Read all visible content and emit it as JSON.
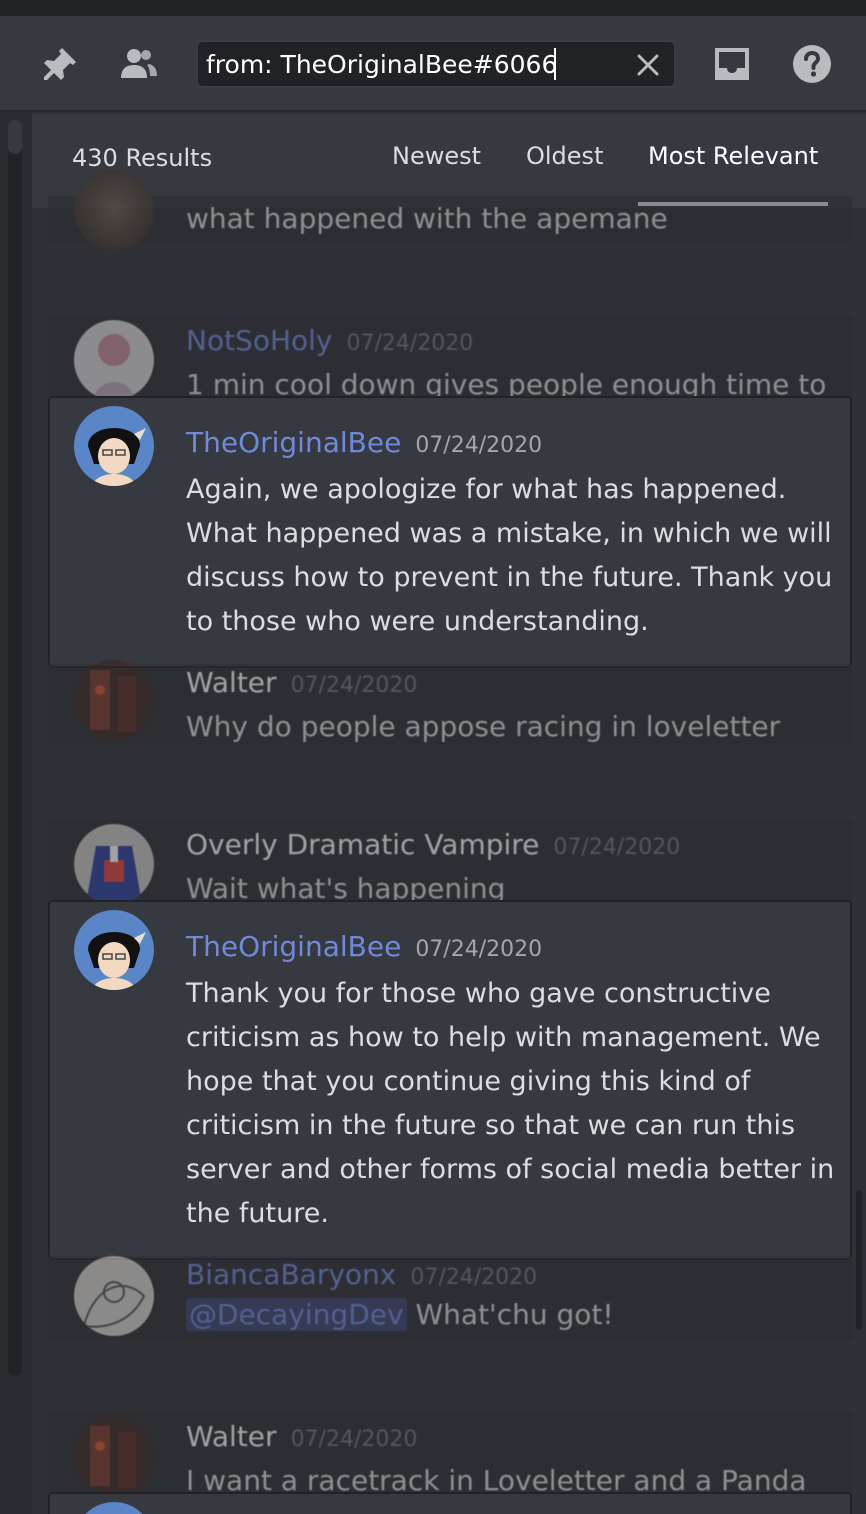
{
  "toolbar": {
    "search_value": "from:  TheOriginalBee#6066",
    "icons": [
      "pin-icon",
      "members-icon",
      "close-icon",
      "inbox-icon",
      "help-icon"
    ]
  },
  "results": {
    "count_label": "430 Results",
    "sort_tabs": [
      "Newest",
      "Oldest",
      "Most Relevant"
    ],
    "active_tab": "Most Relevant"
  },
  "messages": [
    {
      "kind": "context",
      "author": "",
      "timestamp": "",
      "text": "what happened with the apemane"
    },
    {
      "kind": "context",
      "author": "NotSoHoly",
      "timestamp": "07/24/2020",
      "text": "1 min cool down gives people enough time to"
    },
    {
      "kind": "hit",
      "author": "TheOriginalBee",
      "timestamp": "07/24/2020",
      "text": "Again, we apologize for what has happened. What happened was a mistake, in which we will discuss how to prevent in the future. Thank you to those who were understanding."
    },
    {
      "kind": "context",
      "author": "Walter",
      "timestamp": "07/24/2020",
      "text": "Why do people appose racing in loveletter"
    },
    {
      "kind": "context",
      "author": "Overly Dramatic Vampire",
      "timestamp": "07/24/2020",
      "text": "Wait what's happening"
    },
    {
      "kind": "hit",
      "author": "TheOriginalBee",
      "timestamp": "07/24/2020",
      "text": "Thank you for those who gave constructive criticism as how to help with management. We hope that you continue giving this kind of criticism in the future so that we can run this server and other forms of social media better in the future."
    },
    {
      "kind": "context",
      "author": "BiancaBaryonx",
      "timestamp": "07/24/2020",
      "mention": "@DecayingDev",
      "text": "What'chu got!"
    },
    {
      "kind": "context",
      "author": "Walter",
      "timestamp": "07/24/2020",
      "text": "I want a racetrack in Loveletter and a Panda"
    }
  ],
  "colors": {
    "background": "#2f3136",
    "panel": "#36393f",
    "username_accent": "#7289da",
    "timestamp": "#72767d"
  }
}
